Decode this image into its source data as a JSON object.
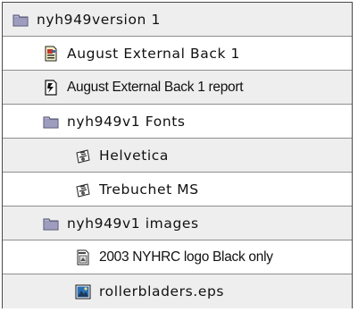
{
  "tree": {
    "rows": [
      {
        "label": "nyh949version 1",
        "icon": "folder-icon",
        "level": 0
      },
      {
        "label": "August External Back 1",
        "icon": "document-icon",
        "level": 1
      },
      {
        "label": "August External Back 1 report",
        "icon": "report-icon",
        "level": 1
      },
      {
        "label": "nyh949v1 Fonts",
        "icon": "folder-icon",
        "level": 1
      },
      {
        "label": "Helvetica",
        "icon": "font-suitcase-icon",
        "level": 2
      },
      {
        "label": "Trebuchet MS",
        "icon": "font-suitcase-icon",
        "level": 2
      },
      {
        "label": "nyh949v1 images",
        "icon": "folder-icon",
        "level": 1
      },
      {
        "label": "2003 NYHRC logo Black only",
        "icon": "eps-file-icon",
        "level": 2
      },
      {
        "label": "rollerbladers.eps",
        "icon": "image-file-icon",
        "level": 2
      }
    ]
  },
  "colors": {
    "border": "#4a4a4a",
    "row_divider": "#8e8e8e",
    "alt_row": "#eeeeee",
    "folder_fill": "#a9a9c9"
  }
}
